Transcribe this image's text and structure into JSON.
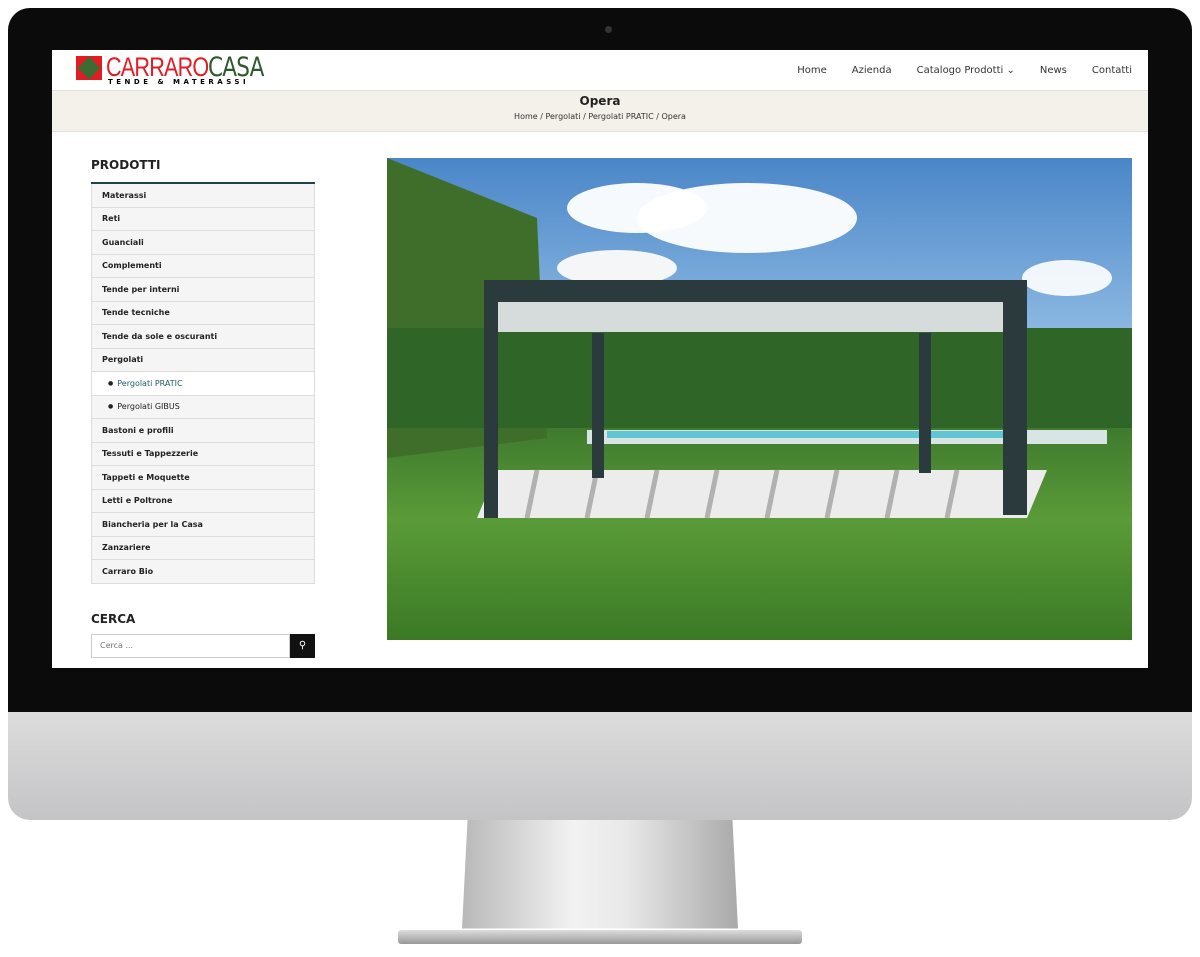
{
  "site": {
    "logo_text_red": "CARRARO",
    "logo_text_green": "CASA",
    "logo_tagline": "TENDE & MATERASSI"
  },
  "nav": [
    {
      "label": "Home"
    },
    {
      "label": "Azienda"
    },
    {
      "label": "Catalogo Prodotti"
    },
    {
      "label": "News"
    },
    {
      "label": "Contatti"
    }
  ],
  "page": {
    "title": "Opera",
    "breadcrumb": [
      "Home",
      "Pergolati",
      "Pergolati PRATIC",
      "Opera"
    ]
  },
  "sidebar": {
    "title": "PRODOTTI",
    "items": [
      {
        "label": "Materassi"
      },
      {
        "label": "Reti"
      },
      {
        "label": "Guanciali"
      },
      {
        "label": "Complementi"
      },
      {
        "label": "Tende per interni"
      },
      {
        "label": "Tende tecniche"
      },
      {
        "label": "Tende da sole e oscuranti"
      },
      {
        "label": "Pergolati"
      },
      {
        "label": "Pergolati PRATIC",
        "sub": true,
        "active": true
      },
      {
        "label": "Pergolati GIBUS",
        "sub": true
      },
      {
        "label": "Bastoni e profili"
      },
      {
        "label": "Tessuti e Tappezzerie"
      },
      {
        "label": "Tappeti e Moquette"
      },
      {
        "label": "Letti e Poltrone"
      },
      {
        "label": "Biancheria per la Casa"
      },
      {
        "label": "Zanzariere"
      },
      {
        "label": "Carraro Bio"
      }
    ]
  },
  "search": {
    "title": "CERCA",
    "placeholder": "Cerca ..."
  },
  "colors": {
    "brand_red": "#e31b23",
    "brand_green": "#2d5a2d",
    "accent": "#24424a"
  }
}
